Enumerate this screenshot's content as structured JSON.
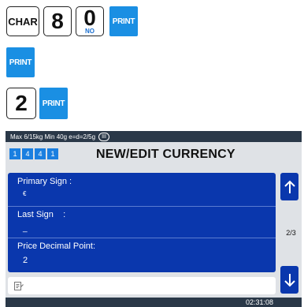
{
  "keys": {
    "char_label": "CHAR",
    "digit_8": "8",
    "digit_0": "0",
    "digit_0_sub": "NO",
    "digit_2": "2",
    "print_label": "PRINT"
  },
  "status": {
    "scale_info": "Max 6/15kg Min 40g e=d=2/5g",
    "class_badge": "III"
  },
  "codes": [
    "1",
    "4",
    "4",
    "1"
  ],
  "title": "NEW/EDIT CURRENCY",
  "fields": {
    "primary_sign_label": "Primary Sign :",
    "primary_sign_value": "€",
    "last_sign_label": "Last Sign    :",
    "last_sign_value": "_",
    "price_decimal_label": "Price Decimal Point:",
    "price_decimal_value": "2"
  },
  "page_indicator": "2/3",
  "clock": "02:31:08",
  "icons": {
    "up": "arrow-up-icon",
    "down": "arrow-down-icon",
    "input": "keyboard-input-icon"
  },
  "colors": {
    "accent": "#1a8fe3",
    "panel": "#0a37ad",
    "statusbar": "#2a3848"
  }
}
